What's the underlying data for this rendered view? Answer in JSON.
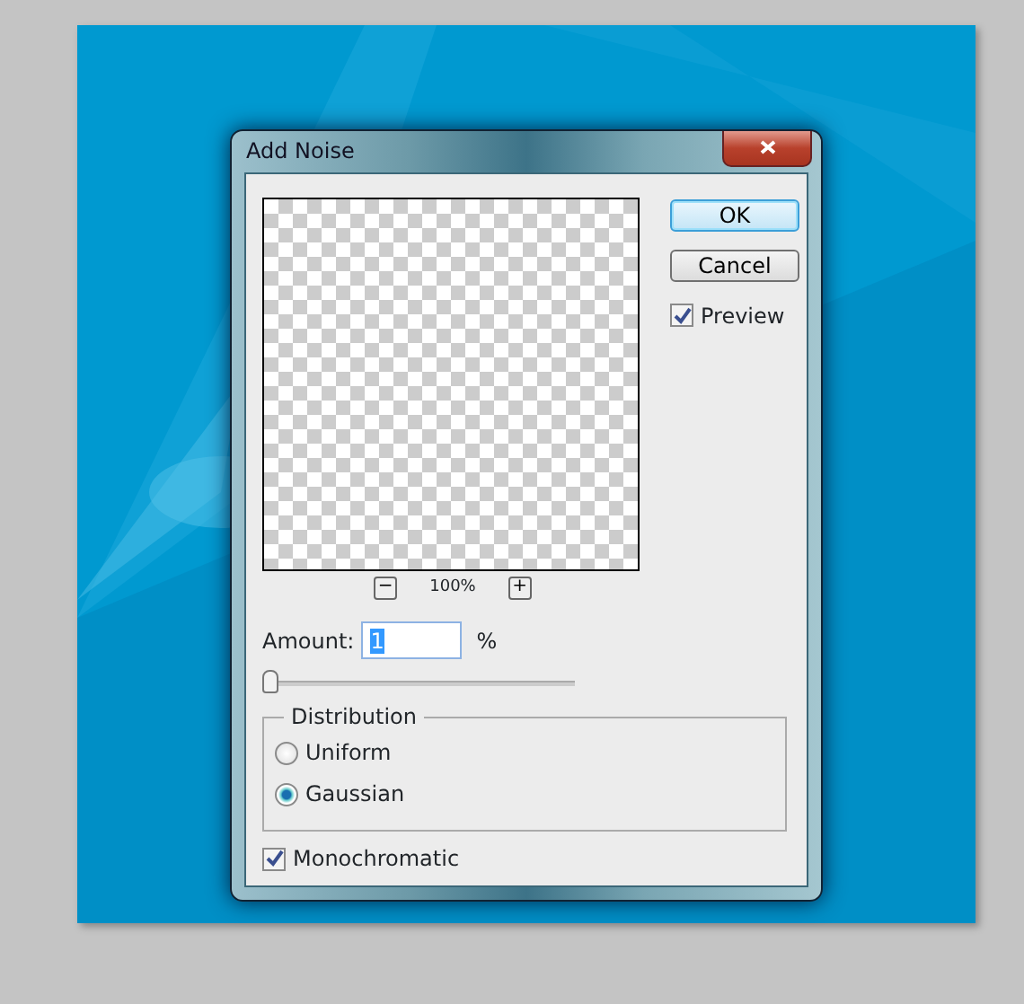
{
  "window": {
    "title": "Add Noise"
  },
  "buttons": [
    {
      "label": "OK",
      "default": true
    },
    {
      "label": "Cancel",
      "default": false
    }
  ],
  "preview_checkbox": {
    "label": "Preview",
    "checked": true
  },
  "zoom": {
    "minus": "−",
    "level": "100%",
    "plus": "+"
  },
  "amount": {
    "label": "Amount:",
    "value": "1",
    "unit": "%",
    "level": 0.0
  },
  "distribution": {
    "legend": "Distribution",
    "options": [
      {
        "label": "Uniform",
        "selected": false
      },
      {
        "label": "Gaussian",
        "selected": true
      }
    ]
  },
  "monochromatic": {
    "label": "Monochromatic",
    "checked": true
  }
}
